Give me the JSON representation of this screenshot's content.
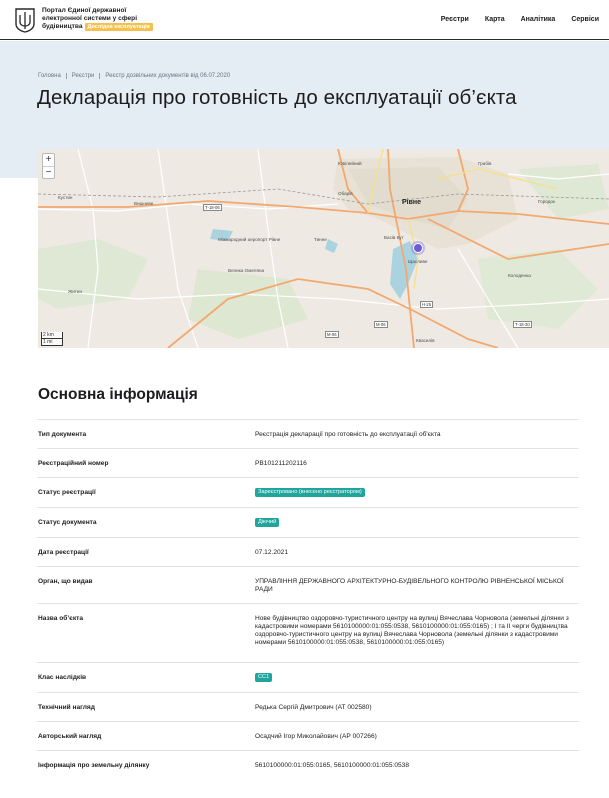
{
  "header": {
    "brand_line1": "Портал Єдиної державної",
    "brand_line2": "електронної системи у сфері",
    "brand_line3": "будівництва",
    "beta_label": "Дослідна експлуатація",
    "nav": [
      "Реєстри",
      "Карта",
      "Аналітика",
      "Сервіси"
    ]
  },
  "breadcrumbs": [
    "Головна",
    "Реєстри",
    "Реєстр дозвільних документів від 06.07.2020"
  ],
  "page_title": "Декларація про готовність до експлуатації об’єкта",
  "map": {
    "zoom_in": "+",
    "zoom_out": "−",
    "scale_km": "2 km",
    "scale_mi": "1 mi",
    "labels": {
      "city": "Рівне",
      "yuvilejnyi": "Ювілейний",
      "hrabiv": "Грабів",
      "velyka_omeliana": "Велика Омеляна",
      "tynne": "Тинне",
      "shchasnyi": "Щасливе",
      "kvasyliv": "Квасилів",
      "bila_krynytsia": "Біла Криниця",
      "maryniv": "Мирне",
      "tytsky": "Дядьковичі",
      "pershe": "Біле",
      "kolodenka": "Колоденка",
      "kurahany": "Корнин",
      "zhytyn": "Житин",
      "boryspil": "Бабин",
      "vyshneve": "Вишневе",
      "korost": "Біла Криниця",
      "mizhnarodnyi": "Міжнародний аеропорт Рівне",
      "klyuchi": "Великий Житин",
      "obariv": "Обарів",
      "olexandrivka": "Олександрія",
      "basiv_kut": "Басів Кут",
      "horodok": "Городок",
      "kustyn": "Кустин",
      "hoshcha": "Гоща",
      "dubliany": "Дубляни"
    },
    "road_tags": [
      "Т-18-06",
      "Т-18-06",
      "М-06",
      "Н-25",
      "Н-25",
      "Т-18-30",
      "Т-18-30",
      "М-06",
      "Е40"
    ]
  },
  "main": {
    "section_title": "Основна інформація",
    "rows": [
      {
        "key": "Тип документа",
        "value": "Реєстрація декларації про готовність до експлуатації об'єкта"
      },
      {
        "key": "Реєстраційний номер",
        "value": "РВ101211202116"
      },
      {
        "key": "Статус реєстрації",
        "value": "Зареєстровано (внесено реєстратором)"
      },
      {
        "key": "Статус документа",
        "value": "Діючий"
      },
      {
        "key": "Дата реєстрації",
        "value": "07.12.2021"
      },
      {
        "key": "Орган, що видав",
        "value": "УПРАВЛІННЯ ДЕРЖАВНОГО АРХІТЕКТУРНО-БУДІВЕЛЬНОГО КОНТРОЛЮ РІВНЕНСЬКОЇ МІСЬКОЇ РАДИ"
      },
      {
        "key": "Назва об’єкта",
        "value": "Нове будівництво оздоровчо-туристичного центру на вулиці Вячеслава Чорновола (земельні ділянки з кадастровими номерами 5610100000:01:055:0538, 5610100000:01:055:0165) ; I та II черги будівництва оздоровчо-туристичного центру на вулиці Вячеслава Чорновола (земельні ділянки з кадастровими номерами 5610100000:01:055:0538, 5610100000:01:055:0165)"
      },
      {
        "key": "Клас наслідків",
        "value": "СС1"
      },
      {
        "key": "Технічний нагляд",
        "value": "Редька Сергій Дмитрович (АТ 002580)"
      },
      {
        "key": "Авторський нагляд",
        "value": "Осадчий Ігор Миколайович (АР 007266)"
      },
      {
        "key": "Інформація про земельну ділянку",
        "value": "5610100000:01:055:0165, 5610100000:01:055:0538"
      }
    ]
  },
  "colors": {
    "hero_bg": "#e4ecf4",
    "badge_green": "#1fa59b",
    "beta_yellow": "#f4c14e",
    "map_marker": "#6b5bd6"
  }
}
